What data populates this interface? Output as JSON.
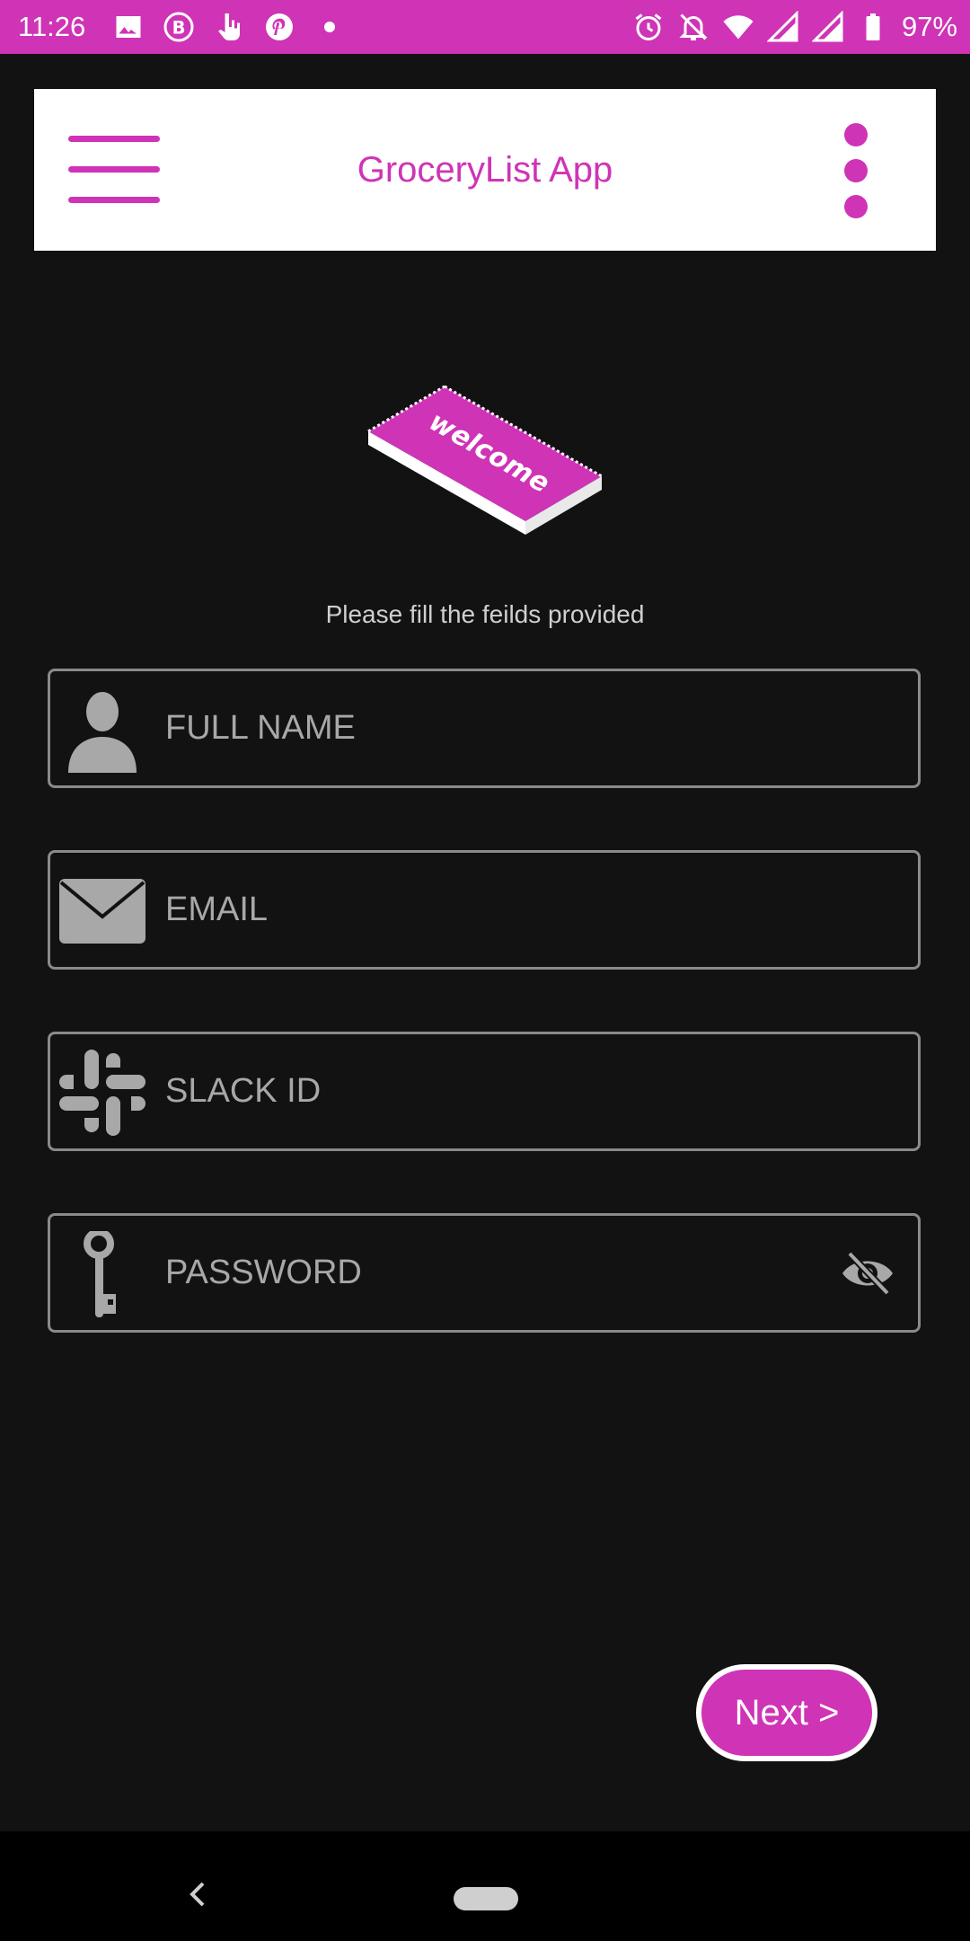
{
  "status_bar": {
    "time": "11:26",
    "battery_text": "97%",
    "left_icons": [
      "image-icon",
      "b-badge-icon",
      "touch-icon",
      "pinterest-icon",
      "dot-icon"
    ],
    "right_icons": [
      "alarm-icon",
      "notifications-off-icon",
      "wifi-icon",
      "signal-icon",
      "signal-icon",
      "battery-icon"
    ],
    "background": "#cf33b6"
  },
  "app_bar": {
    "title": "GroceryList App",
    "menu_icon": "hamburger-menu-icon",
    "more_icon": "more-vert-icon"
  },
  "welcome_art": {
    "text": "welcome"
  },
  "form": {
    "subtitle": "Please fill the feilds provided",
    "fields": [
      {
        "icon": "person-icon",
        "placeholder": "FULL NAME",
        "value": ""
      },
      {
        "icon": "envelope-icon",
        "placeholder": "EMAIL",
        "value": ""
      },
      {
        "icon": "slack-icon",
        "placeholder": "SLACK ID",
        "value": ""
      },
      {
        "icon": "key-icon",
        "placeholder": "PASSWORD",
        "value": "",
        "toggle_icon": "visibility-off-icon"
      }
    ]
  },
  "next_button": {
    "label": "Next >"
  },
  "nav_bar": {
    "back_icon": "back-chevron-icon",
    "home_icon": "home-pill-icon"
  },
  "colors": {
    "accent": "#cf33b6",
    "background": "#121212",
    "field_border": "#8a8a8a",
    "icon_gray": "#a8a8a8"
  }
}
